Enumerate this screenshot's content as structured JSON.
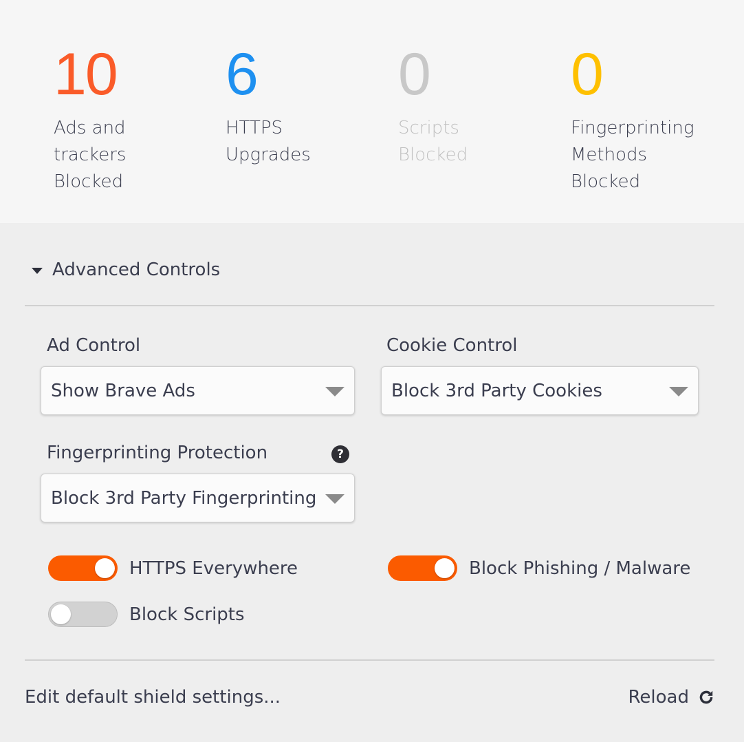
{
  "stats": [
    {
      "value": "10",
      "label": "Ads and trackers Blocked",
      "color": "#fa5b29"
    },
    {
      "value": "6",
      "label": "HTTPS Upgrades",
      "color": "#1e90f0"
    },
    {
      "value": "0",
      "label": "Scripts Blocked",
      "color": "#c8c8c8"
    },
    {
      "value": "0",
      "label": "Fingerprinting Methods Blocked",
      "color": "#fec000"
    }
  ],
  "advanced": {
    "title": "Advanced Controls",
    "ad_control": {
      "label": "Ad Control",
      "value": "Show Brave Ads"
    },
    "cookie_control": {
      "label": "Cookie Control",
      "value": "Block 3rd Party Cookies"
    },
    "fingerprinting": {
      "label": "Fingerprinting Protection",
      "value": "Block 3rd Party Fingerprinting",
      "help_icon": "question-circle-icon"
    },
    "toggles": {
      "https_everywhere": {
        "label": "HTTPS Everywhere",
        "on": true
      },
      "block_phishing": {
        "label": "Block Phishing / Malware",
        "on": true
      },
      "block_scripts": {
        "label": "Block Scripts",
        "on": false
      }
    }
  },
  "footer": {
    "edit_link": "Edit default shield settings...",
    "reload": "Reload",
    "reload_icon": "reload-icon"
  },
  "colors": {
    "accent": "#fb5b00",
    "toggle_off": "#d2d2d2"
  }
}
